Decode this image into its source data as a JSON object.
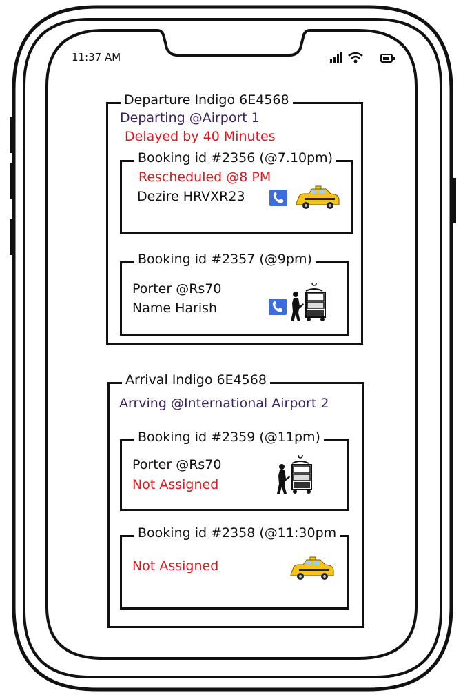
{
  "status_bar": {
    "time": "11:37 AM"
  },
  "departure": {
    "legend": "Departure Indigo 6E4568",
    "location": "Departing @Airport 1",
    "delay": "Delayed by 40 Minutes",
    "bookings": [
      {
        "legend": "Booking id #2356 (@7.10pm)",
        "status": "Rescheduled @8 PM",
        "vehicle": "Dezire HRVXR23",
        "icon": "taxi-icon"
      },
      {
        "legend": "Booking id #2357 (@9pm)",
        "service": "Porter @Rs70",
        "name": "Name Harish",
        "icon": "porter-icon"
      }
    ]
  },
  "arrival": {
    "legend": "Arrival Indigo 6E4568",
    "location": "Arrving @International Airport 2",
    "bookings": [
      {
        "legend": "Booking id #2359 (@11pm)",
        "service": "Porter @Rs70",
        "status": "Not Assigned",
        "icon": "porter-icon"
      },
      {
        "legend": "Booking id #2358 (@11:30pm",
        "status": "Not Assigned",
        "icon": "taxi-icon"
      }
    ]
  },
  "colors": {
    "alert": "#e0161d",
    "call_button": "#3d6ddb",
    "taxi": "#f6c318",
    "text_accent": "#3a2260"
  }
}
